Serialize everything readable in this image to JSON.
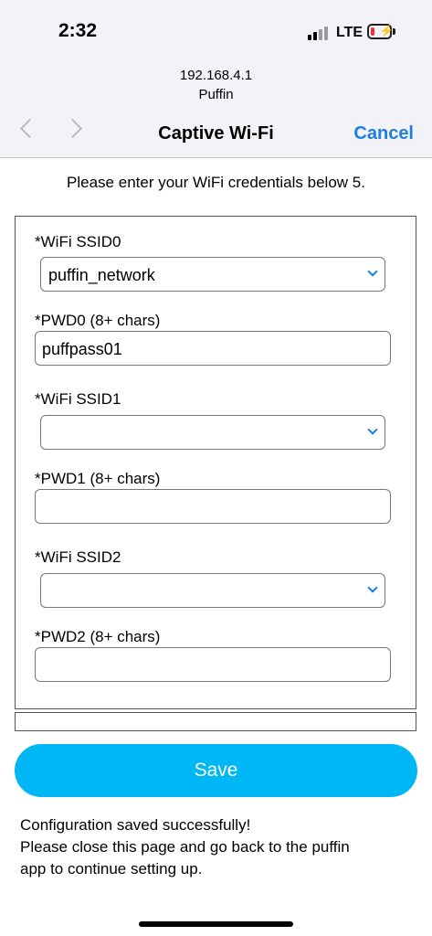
{
  "status_bar": {
    "time": "2:32",
    "network": "LTE",
    "battery_level": 0.2,
    "battery_color": "#e5333c",
    "charging_icon": "bolt-icon"
  },
  "browser": {
    "host": "192.168.4.1",
    "app_name": "Puffin",
    "title": "Captive Wi-Fi",
    "cancel_label": "Cancel",
    "back_icon": "chevron-left-icon",
    "forward_icon": "chevron-right-icon"
  },
  "page": {
    "intro": "Please enter your WiFi credentials below 5.",
    "fields": [
      {
        "ssid_label": "*WiFi SSID0",
        "ssid_value": "puffin_network",
        "pwd_label": "*PWD0 (8+ chars)",
        "pwd_value": "puffpass01"
      },
      {
        "ssid_label": "*WiFi SSID1",
        "ssid_value": "",
        "pwd_label": "*PWD1 (8+ chars)",
        "pwd_value": ""
      },
      {
        "ssid_label": "*WiFi SSID2",
        "ssid_value": "",
        "pwd_label": "*PWD2 (8+ chars)",
        "pwd_value": ""
      }
    ],
    "save_label": "Save",
    "save_color": "#00b7f5",
    "message_line1": "Configuration saved successfully!",
    "message_line2": "Please close this page and go back to the puffin",
    "message_line3": "app to continue setting up."
  }
}
